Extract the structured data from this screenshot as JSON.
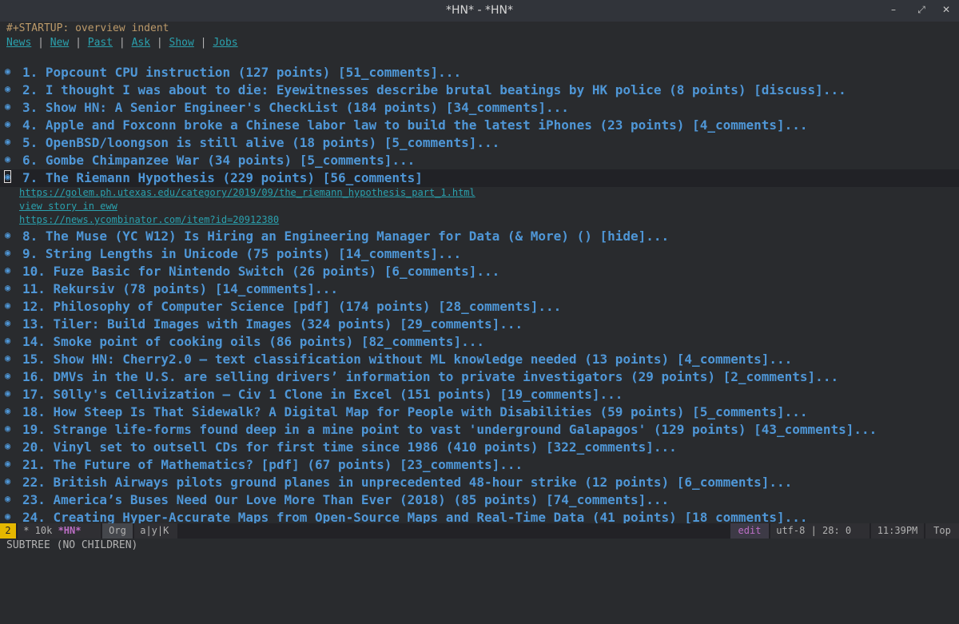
{
  "window": {
    "title": "*HN* - *HN*",
    "buttons": [
      "–",
      "⤢",
      "✕"
    ]
  },
  "buffer": {
    "startup": "#+STARTUP: overview indent",
    "nav": [
      "News",
      "New",
      "Past",
      "Ask",
      "Show",
      "Jobs"
    ],
    "nav_sep": " | ",
    "items": [
      "1. Popcount CPU instruction (127 points) [51_comments]...",
      "2. I thought I was about to die: Eyewitnesses describe brutal beatings by HK police (8 points) [discuss]...",
      "3. Show HN: A Senior Engineer's CheckList (184 points) [34_comments]...",
      "4. Apple and Foxconn broke a Chinese labor law to build the latest iPhones (23 points) [4_comments]...",
      "5. OpenBSD/loongson is still alive (18 points) [5_comments]...",
      "6. Gombe Chimpanzee War (34 points) [5_comments]...",
      "7. The Riemann Hypothesis (229 points) [56_comments]",
      "8. The Muse (YC W12) Is Hiring an Engineering Manager for Data (& More) () [hide]...",
      "9. String Lengths in Unicode (75 points) [14_comments]...",
      "10. Fuze Basic for Nintendo Switch (26 points) [6_comments]...",
      "11. Rekursiv (78 points) [14_comments]...",
      "12. Philosophy of Computer Science [pdf] (174 points) [28_comments]...",
      "13. Tiler: Build Images with Images (324 points) [29_comments]...",
      "14. Smoke point of cooking oils (86 points) [82_comments]...",
      "15. Show HN: Cherry2.0 – text classification without ML knowledge needed (13 points) [4_comments]...",
      "16. DMVs in the U.S. are selling drivers’ information to private investigators (29 points) [2_comments]...",
      "17. S0lly's Cellivization – Civ 1 Clone in Excel (151 points) [19_comments]...",
      "18. How Steep Is That Sidewalk? A Digital Map for People with Disabilities (59 points) [5_comments]...",
      "19. Strange life-forms found deep in a mine point to vast 'underground Galapagos' (129 points) [43_comments]...",
      "20. Vinyl set to outsell CDs for first time since 1986 (410 points) [322_comments]...",
      "21. The Future of Mathematics? [pdf] (67 points) [23_comments]...",
      "22. British Airways pilots ground planes in unprecedented 48-hour strike (12 points) [6_comments]...",
      "23. America’s Buses Need Our Love More Than Ever (2018) (85 points) [74_comments]...",
      "24. Creating Hyper-Accurate Maps from Open-Source Maps and Real-Time Data (41 points) [18_comments]..."
    ],
    "expanded_links": [
      "https://golem.ph.utexas.edu/category/2019/09/the_riemann_hypothesis_part_1.html",
      "view story in eww",
      "https://news.ycombinator.com/item?id=20912380"
    ]
  },
  "modeline": {
    "window_number": "2",
    "buffer_state": " * 10k ",
    "buffer_name": "*HN*",
    "major_mode": "Org",
    "minor": " a|y|K",
    "edit_state": "edit",
    "encoding": " utf-8 | 28: 0",
    "time": "11:39PM",
    "position": "Top"
  },
  "echo_area": "SUBTREE (NO CHILDREN)"
}
